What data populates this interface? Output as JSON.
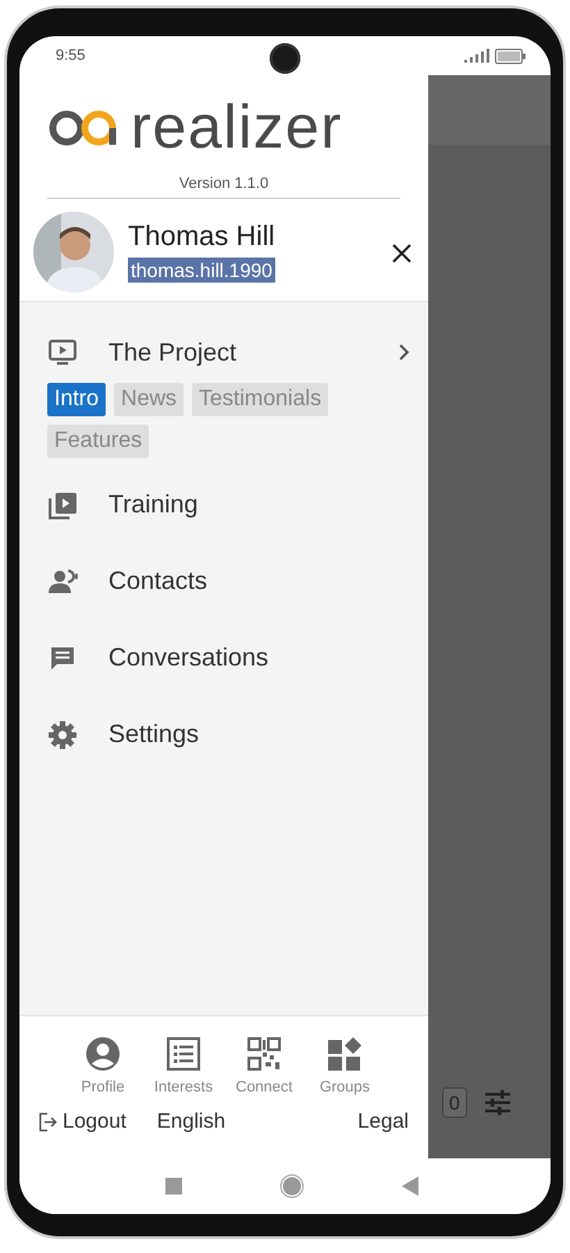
{
  "status_bar": {
    "time": "9:55"
  },
  "app": {
    "logo_text": "realizer",
    "version": "Version 1.1.0"
  },
  "user": {
    "name": "Thomas Hill",
    "username": "thomas.hill.1990",
    "username_highlighted": true
  },
  "menu": [
    {
      "kind": "expandable",
      "label": "The Project",
      "tags": [
        {
          "label": "Intro",
          "selected": true
        },
        {
          "label": "News",
          "selected": false
        },
        {
          "label": "Testimonials",
          "selected": false
        },
        {
          "label": "Features",
          "selected": false
        }
      ]
    },
    {
      "kind": "plain",
      "label": "Training"
    },
    {
      "kind": "plain",
      "label": "Contacts"
    },
    {
      "kind": "plain",
      "label": "Conversations"
    },
    {
      "kind": "plain",
      "label": "Settings"
    }
  ],
  "footer_nav": [
    {
      "label": "Profile"
    },
    {
      "label": "Interests"
    },
    {
      "label": "Connect"
    },
    {
      "label": "Groups"
    }
  ],
  "footer_links": {
    "logout": "Logout",
    "language": "English",
    "legal": "Legal"
  },
  "background": {
    "counter": "0"
  }
}
